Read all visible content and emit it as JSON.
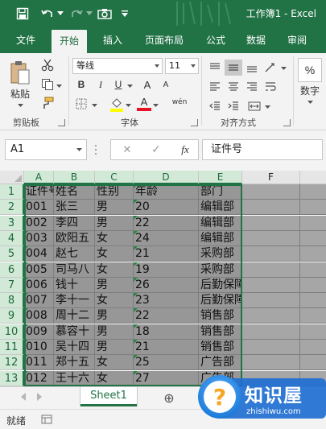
{
  "window": {
    "title": "工作簿1  -  Excel"
  },
  "ribbon_tabs": [
    "文件",
    "开始",
    "插入",
    "页面布局",
    "公式",
    "数据",
    "审阅"
  ],
  "active_tab": "开始",
  "clipboard": {
    "paste_label": "粘贴",
    "group_label": "剪贴板"
  },
  "font": {
    "name": "等线",
    "size": "11",
    "bold": "B",
    "italic": "I",
    "underline": "U",
    "grow": "A",
    "shrink": "A",
    "font_color": "A",
    "phonetic": "wén",
    "group_label": "字体"
  },
  "alignment": {
    "group_label": "对齐方式"
  },
  "number": {
    "percent": "%",
    "label": "数字"
  },
  "formula_bar": {
    "name_box": "A1",
    "cancel": "✕",
    "enter": "✓",
    "fx": "fx",
    "content": "证件号"
  },
  "columns": [
    "A",
    "B",
    "C",
    "D",
    "E",
    "F"
  ],
  "rows": [
    "1",
    "2",
    "3",
    "4",
    "5",
    "6",
    "7",
    "8",
    "9",
    "10",
    "11",
    "12",
    "13"
  ],
  "table": [
    [
      "证件号",
      "姓名",
      "性别",
      "年龄",
      "部门"
    ],
    [
      "001",
      "张三",
      "男",
      "20",
      "编辑部"
    ],
    [
      "002",
      "李四",
      "男",
      "22",
      "编辑部"
    ],
    [
      "003",
      "欧阳五",
      "女",
      "24",
      "编辑部"
    ],
    [
      "004",
      "赵七",
      "女",
      "21",
      "采购部"
    ],
    [
      "005",
      "司马八",
      "女",
      "19",
      "采购部"
    ],
    [
      "006",
      "钱十",
      "男",
      "26",
      "后勤保障部"
    ],
    [
      "007",
      "李十一",
      "女",
      "23",
      "后勤保障部"
    ],
    [
      "008",
      "周十二",
      "男",
      "22",
      "销售部"
    ],
    [
      "009",
      "慕容十",
      "男",
      "18",
      "销售部"
    ],
    [
      "010",
      "吴十四",
      "男",
      "21",
      "销售部"
    ],
    [
      "011",
      "郑十五",
      "女",
      "25",
      "广告部"
    ],
    [
      "012",
      "王十六",
      "女",
      "27",
      "广告部"
    ]
  ],
  "sheets": {
    "active": "Sheet1",
    "add": "⊕"
  },
  "status": {
    "ready": "就绪"
  },
  "watermark": {
    "text": "知识屋",
    "url": "zhishiwu.com"
  },
  "colors": {
    "accent": "#217346",
    "selection_fill": "#979797"
  }
}
